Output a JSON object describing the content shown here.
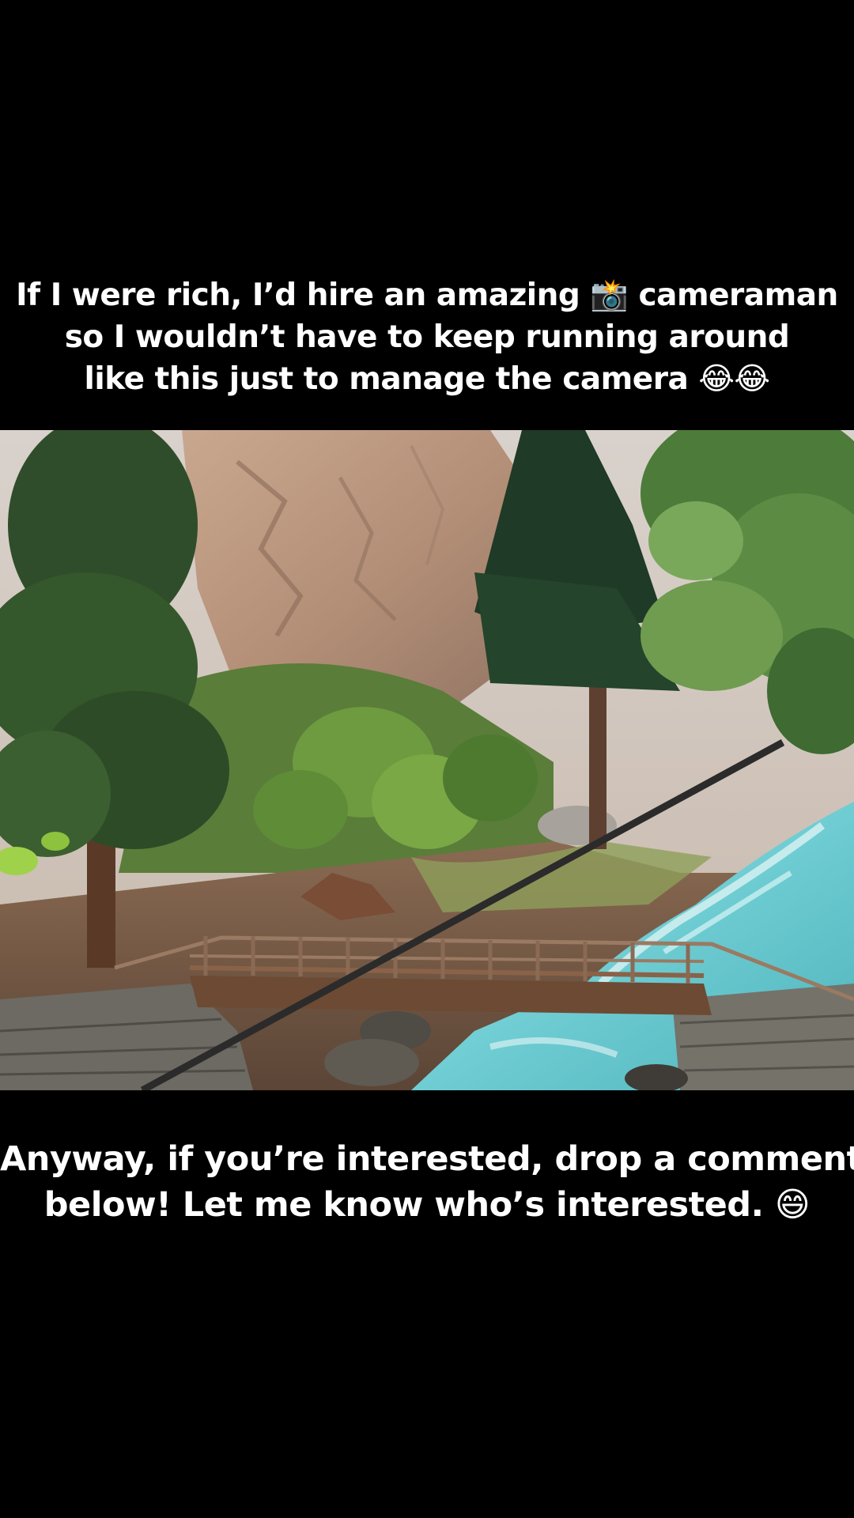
{
  "top_caption": {
    "lines": [
      "If I were rich, I’d hire an amazing 📸 cameraman",
      "so I wouldn’t have to keep running around",
      "like this just to manage the camera 😂😂"
    ]
  },
  "photo": {
    "subject": "mountain-river-footbridge-photo"
  },
  "bottom_caption": {
    "lines": [
      "Anyway, if you’re interested, drop a comment",
      "below! Let me know who’s interested. 😄"
    ]
  },
  "colors": {
    "background": "#000000",
    "text": "#ffffff",
    "river": "#7fd3d9",
    "foliage": "#3f6b2c",
    "rock": "#b9987e"
  }
}
